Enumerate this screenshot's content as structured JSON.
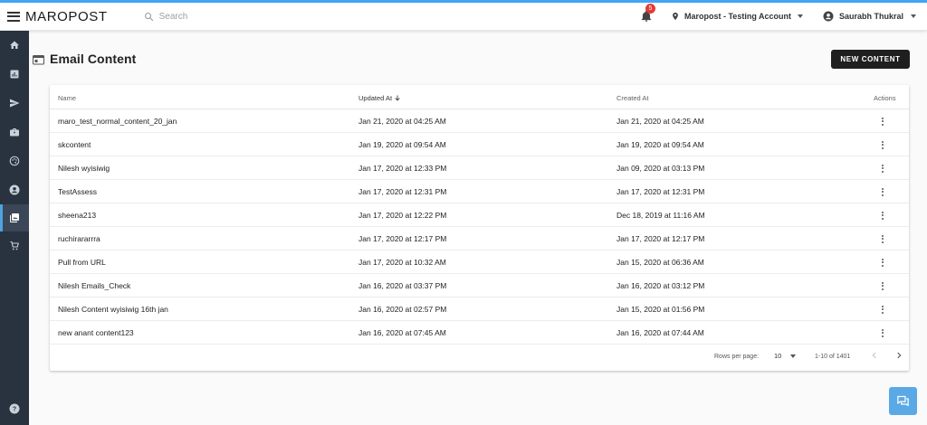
{
  "header": {
    "logo": "MAROPOST",
    "search_placeholder": "Search",
    "notification_count": "5",
    "account_name": "Maropost - Testing Account",
    "user_name": "Saurabh Thukral"
  },
  "sidebar": {
    "items": [
      {
        "icon": "home-icon"
      },
      {
        "icon": "reports-icon"
      },
      {
        "icon": "send-icon"
      },
      {
        "icon": "briefcase-icon"
      },
      {
        "icon": "palette-icon"
      },
      {
        "icon": "contact-icon"
      },
      {
        "icon": "content-library-icon"
      },
      {
        "icon": "cart-icon"
      },
      {
        "icon": "help-icon"
      }
    ],
    "active_index": 6
  },
  "page": {
    "title": "Email Content",
    "new_button": "NEW CONTENT"
  },
  "table": {
    "headers": {
      "name": "Name",
      "updated_at": "Updated At",
      "created_at": "Created At",
      "actions": "Actions"
    },
    "rows": [
      {
        "name": "maro_test_normal_content_20_jan",
        "updated": "Jan 21, 2020 at 04:25 AM",
        "created": "Jan 21, 2020 at 04:25 AM"
      },
      {
        "name": "skcontent",
        "updated": "Jan 19, 2020 at 09:54 AM",
        "created": "Jan 19, 2020 at 09:54 AM"
      },
      {
        "name": "Nilesh wyisiwig",
        "updated": "Jan 17, 2020 at 12:33 PM",
        "created": "Jan 09, 2020 at 03:13 PM"
      },
      {
        "name": "TestAssess",
        "updated": "Jan 17, 2020 at 12:31 PM",
        "created": "Jan 17, 2020 at 12:31 PM"
      },
      {
        "name": "sheena213",
        "updated": "Jan 17, 2020 at 12:22 PM",
        "created": "Dec 18, 2019 at 11:16 AM"
      },
      {
        "name": "ruchirararrra",
        "updated": "Jan 17, 2020 at 12:17 PM",
        "created": "Jan 17, 2020 at 12:17 PM"
      },
      {
        "name": "Pull from URL",
        "updated": "Jan 17, 2020 at 10:32 AM",
        "created": "Jan 15, 2020 at 06:36 AM"
      },
      {
        "name": "Nilesh Emails_Check",
        "updated": "Jan 16, 2020 at 03:37 PM",
        "created": "Jan 16, 2020 at 03:12 PM"
      },
      {
        "name": "Nilesh Content wyisiwig 16th jan",
        "updated": "Jan 16, 2020 at 02:57 PM",
        "created": "Jan 15, 2020 at 01:56 PM"
      },
      {
        "name": "new anant content123",
        "updated": "Jan 16, 2020 at 07:45 AM",
        "created": "Jan 16, 2020 at 07:44 AM"
      }
    ]
  },
  "pagination": {
    "rows_per_page_label": "Rows per page:",
    "rows_per_page": "10",
    "range": "1-10 of 1401"
  },
  "colors": {
    "accent": "#42a5f5",
    "sidebar": "#29333f",
    "primary_button": "#1f1f1f",
    "badge": "#e53935",
    "chat_button": "#5aa9e6"
  }
}
